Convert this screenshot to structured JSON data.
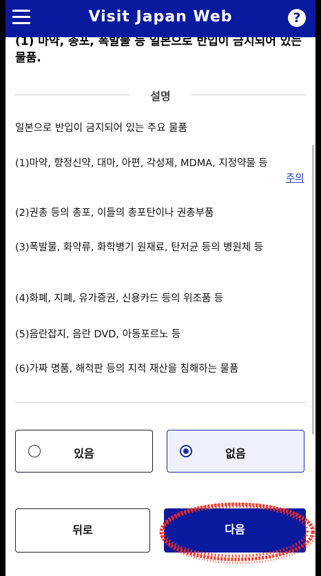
{
  "header": {
    "title": "Visit Japan Web",
    "menu_icon": "hamburger-menu-icon",
    "help_icon": "help-icon",
    "help_symbol": "?"
  },
  "question": "(1) 마약, 총포, 폭발물 등 일본으로 반입이 금지되어 있는 물품.",
  "section": {
    "title": "설명",
    "intro": "일본으로 반입이 금지되어 있는 주요 물품",
    "items": [
      "(1)마약, 향정신약, 대마, 아편, 각성제, MDMA, 지정약물 등",
      "(2)권총 등의 총포, 이들의 총포탄이나 권총부품",
      "(3)폭발물, 화약류, 화학병기 원재료, 탄저균 등의 병원체 등",
      "(4)화폐, 지폐, 유가증권, 신용카드 등의 위조품 등",
      "(5)음란잡지, 음란 DVD, 아동포르노 등",
      "(6)가짜 명품, 해적판 등의 지적 재산을 침해하는 물품"
    ],
    "caution_link": "주의"
  },
  "choices": {
    "yes_label": "있음",
    "no_label": "없음",
    "selected": "no"
  },
  "buttons": {
    "back_label": "뒤로",
    "next_label": "다음"
  },
  "colors": {
    "brand": "#0a1a9e",
    "highlight": "#ff2a1a"
  }
}
